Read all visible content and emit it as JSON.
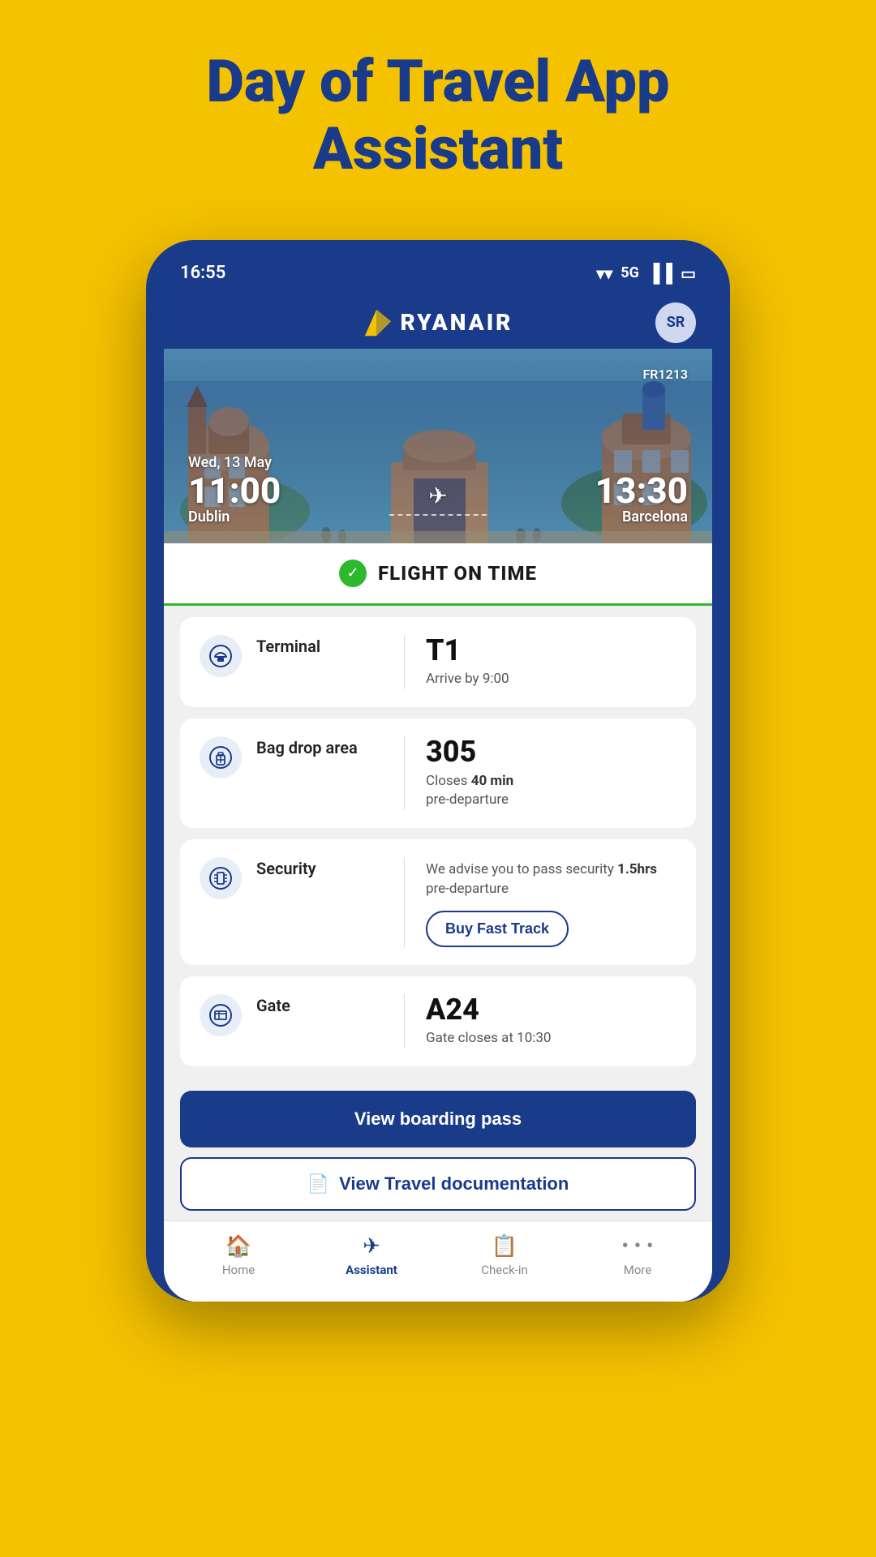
{
  "page": {
    "title_line1": "Day of Travel App",
    "title_line2": "Assistant"
  },
  "status_bar": {
    "time": "16:55",
    "wifi_label": "wifi",
    "signal_label": "5G",
    "battery_label": "battery"
  },
  "header": {
    "logo_text": "RYANAIR",
    "avatar_initials": "SR"
  },
  "flight": {
    "date": "Wed, 13 May",
    "flight_number": "FR1213",
    "departure_time": "11:00",
    "departure_city": "Dublin",
    "arrival_time": "13:30",
    "arrival_city": "Barcelona"
  },
  "status_banner": {
    "text": "FLIGHT ON TIME",
    "status_color": "#2db82d"
  },
  "cards": [
    {
      "id": "terminal",
      "label": "Terminal",
      "main_value": "T1",
      "sub_value": "Arrive by 9:00",
      "sub_bold": ""
    },
    {
      "id": "bag_drop",
      "label": "Bag drop area",
      "main_value": "305",
      "sub_value_prefix": "Closes ",
      "sub_value_bold": "40 min",
      "sub_value_suffix": "\npre-departure"
    },
    {
      "id": "security",
      "label": "Security",
      "main_value": "",
      "sub_value_prefix": "We advise you to pass security ",
      "sub_value_bold": "1.5hrs",
      "sub_value_suffix": "\npre-departure",
      "cta_label": "Buy Fast Track"
    },
    {
      "id": "gate",
      "label": "Gate",
      "main_value": "A24",
      "sub_value": "Gate closes at 10:30",
      "sub_bold": ""
    }
  ],
  "buttons": {
    "boarding_pass": "View boarding pass",
    "travel_doc": "View Travel documentation"
  },
  "bottom_nav": [
    {
      "id": "home",
      "label": "Home",
      "icon": "🏠",
      "active": false
    },
    {
      "id": "assistant",
      "label": "Assistant",
      "icon": "✈",
      "active": true
    },
    {
      "id": "checkin",
      "label": "Check-in",
      "icon": "📋",
      "active": false
    },
    {
      "id": "more",
      "label": "More",
      "icon": "···",
      "active": false
    }
  ]
}
